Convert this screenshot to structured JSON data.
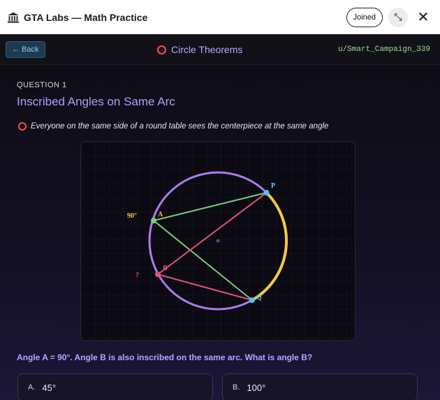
{
  "header": {
    "app_title": "GTA Labs — Math Practice",
    "joined_label": "Joined",
    "expand_icon": "⤡",
    "close_icon": "✕"
  },
  "subbar": {
    "back_label": "← Back",
    "topic": "Circle Theorems",
    "username": "u/Smart_Campaign_339"
  },
  "question": {
    "number_label": "QUESTION 1",
    "title": "Inscribed Angles on Same Arc",
    "hint": "Everyone on the same side of a round table sees the centerpiece at the same angle",
    "prompt": "Angle A = 90°. Angle B is also inscribed on the same arc. What is angle B?"
  },
  "diagram": {
    "points": {
      "P": "P",
      "Q": "Q",
      "A": "A",
      "B": "B"
    },
    "angle_a_label": "90°",
    "angle_b_label": "?",
    "colors": {
      "circle": "#a97cf0",
      "arc": "#f5c842",
      "line_a": "#7cc97c",
      "line_b": "#e0507a",
      "point_p": "#4fc3f7",
      "point_a": "#7cc97c",
      "point_b": "#e0507a",
      "center": "#4b4b8a"
    }
  },
  "options": [
    {
      "letter": "A.",
      "value": "45°"
    },
    {
      "letter": "B.",
      "value": "100°"
    }
  ],
  "colors": {
    "accent": "#b59cff",
    "topic_ring": "#ff4b4b",
    "username": "#9fdc8f"
  }
}
